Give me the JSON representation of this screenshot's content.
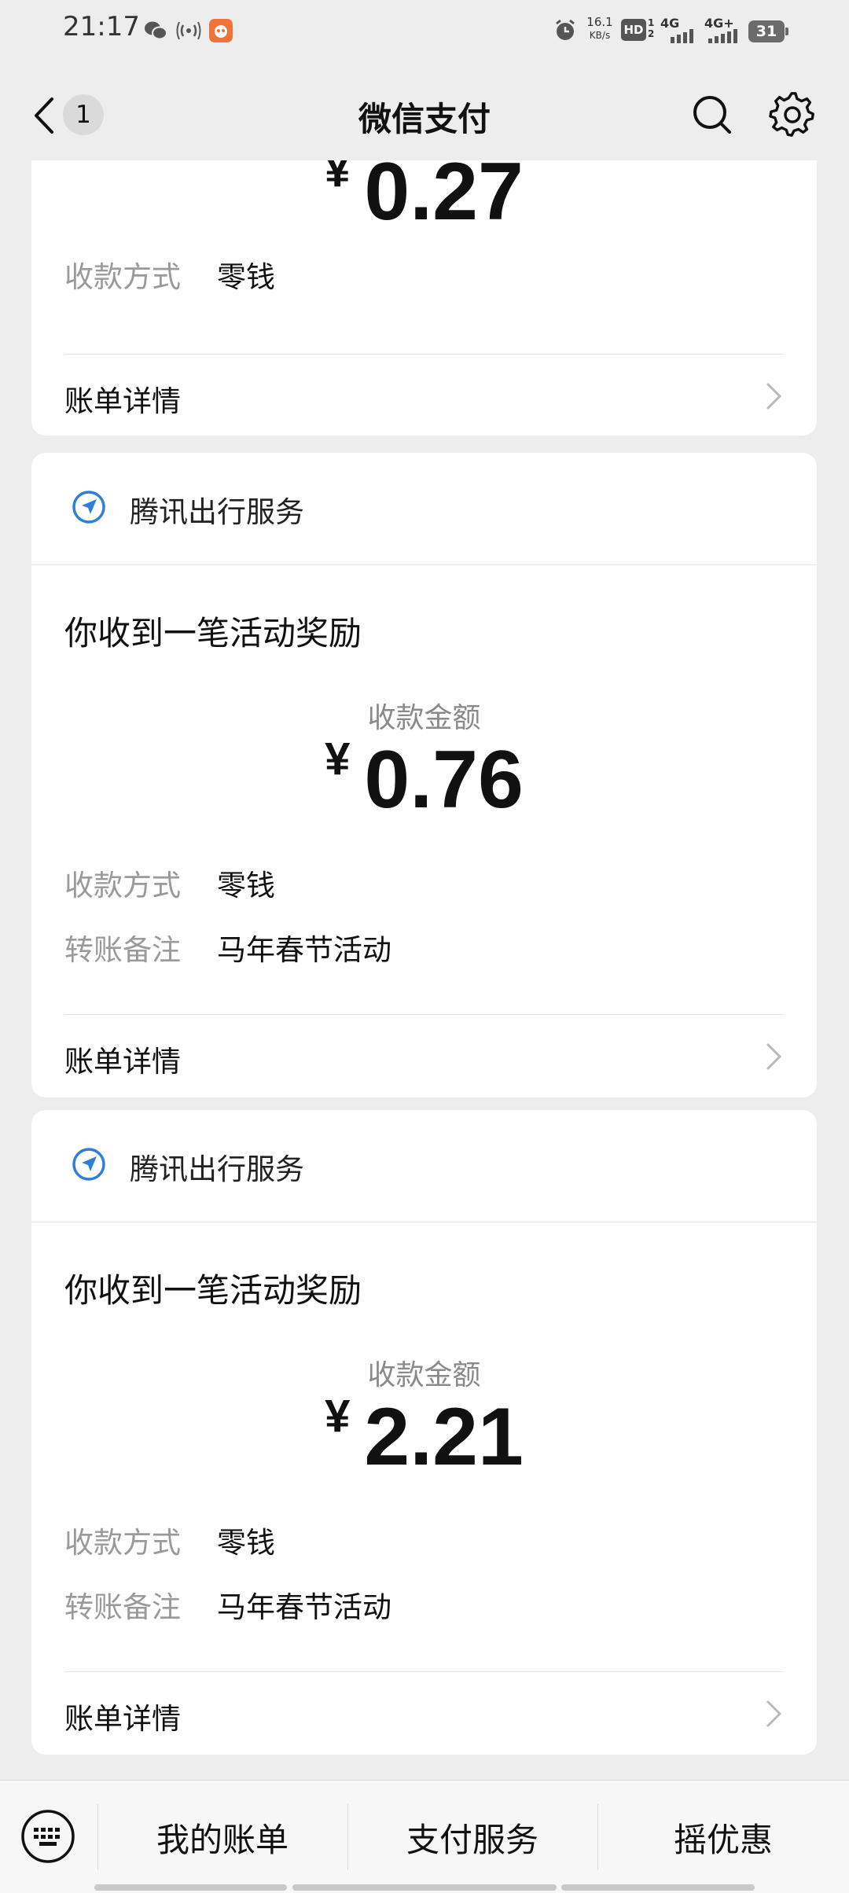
{
  "status_bar": {
    "time": "21:17",
    "net_speed_value": "16.1",
    "net_speed_unit": "KB/s",
    "hd_badge": "HD",
    "network_1": "4G",
    "network_2": "4G+",
    "battery": "31",
    "icons": [
      "wechat-icon",
      "hotspot-icon",
      "app-icon",
      "alarm-icon",
      "signal-icon"
    ]
  },
  "nav": {
    "badge_count": "1",
    "title": "微信支付",
    "icons": [
      "back-chevron-icon",
      "search-icon",
      "gear-icon"
    ]
  },
  "cards": [
    {
      "amount_symbol": "¥",
      "amount": "0.27",
      "method_label": "收款方式",
      "method_value": "零钱",
      "detail_label": "账单详情"
    },
    {
      "service_name": "腾讯出行服务",
      "message": "你收到一笔活动奖励",
      "amount_label": "收款金额",
      "amount_symbol": "¥",
      "amount": "0.76",
      "method_label": "收款方式",
      "method_value": "零钱",
      "note_label": "转账备注",
      "note_value": "马年春节活动",
      "detail_label": "账单详情"
    },
    {
      "service_name": "腾讯出行服务",
      "message": "你收到一笔活动奖励",
      "amount_label": "收款金额",
      "amount_symbol": "¥",
      "amount": "2.21",
      "method_label": "收款方式",
      "method_value": "零钱",
      "note_label": "转账备注",
      "note_value": "马年春节活动",
      "detail_label": "账单详情"
    }
  ],
  "bottom_menu": {
    "items": [
      "我的账单",
      "支付服务",
      "摇优惠"
    ]
  },
  "colors": {
    "background": "#ededed",
    "card": "#ffffff",
    "service_icon": "#2f7fd8",
    "muted_text": "#9a9a9a"
  }
}
